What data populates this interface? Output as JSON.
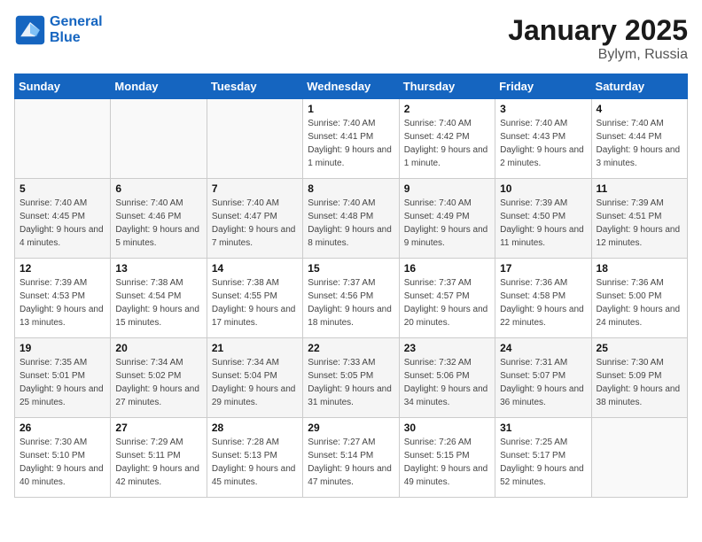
{
  "header": {
    "logo_line1": "General",
    "logo_line2": "Blue",
    "title": "January 2025",
    "subtitle": "Bylym, Russia"
  },
  "weekdays": [
    "Sunday",
    "Monday",
    "Tuesday",
    "Wednesday",
    "Thursday",
    "Friday",
    "Saturday"
  ],
  "weeks": [
    [
      {
        "day": "",
        "info": ""
      },
      {
        "day": "",
        "info": ""
      },
      {
        "day": "",
        "info": ""
      },
      {
        "day": "1",
        "info": "Sunrise: 7:40 AM\nSunset: 4:41 PM\nDaylight: 9 hours and 1 minute."
      },
      {
        "day": "2",
        "info": "Sunrise: 7:40 AM\nSunset: 4:42 PM\nDaylight: 9 hours and 1 minute."
      },
      {
        "day": "3",
        "info": "Sunrise: 7:40 AM\nSunset: 4:43 PM\nDaylight: 9 hours and 2 minutes."
      },
      {
        "day": "4",
        "info": "Sunrise: 7:40 AM\nSunset: 4:44 PM\nDaylight: 9 hours and 3 minutes."
      }
    ],
    [
      {
        "day": "5",
        "info": "Sunrise: 7:40 AM\nSunset: 4:45 PM\nDaylight: 9 hours and 4 minutes."
      },
      {
        "day": "6",
        "info": "Sunrise: 7:40 AM\nSunset: 4:46 PM\nDaylight: 9 hours and 5 minutes."
      },
      {
        "day": "7",
        "info": "Sunrise: 7:40 AM\nSunset: 4:47 PM\nDaylight: 9 hours and 7 minutes."
      },
      {
        "day": "8",
        "info": "Sunrise: 7:40 AM\nSunset: 4:48 PM\nDaylight: 9 hours and 8 minutes."
      },
      {
        "day": "9",
        "info": "Sunrise: 7:40 AM\nSunset: 4:49 PM\nDaylight: 9 hours and 9 minutes."
      },
      {
        "day": "10",
        "info": "Sunrise: 7:39 AM\nSunset: 4:50 PM\nDaylight: 9 hours and 11 minutes."
      },
      {
        "day": "11",
        "info": "Sunrise: 7:39 AM\nSunset: 4:51 PM\nDaylight: 9 hours and 12 minutes."
      }
    ],
    [
      {
        "day": "12",
        "info": "Sunrise: 7:39 AM\nSunset: 4:53 PM\nDaylight: 9 hours and 13 minutes."
      },
      {
        "day": "13",
        "info": "Sunrise: 7:38 AM\nSunset: 4:54 PM\nDaylight: 9 hours and 15 minutes."
      },
      {
        "day": "14",
        "info": "Sunrise: 7:38 AM\nSunset: 4:55 PM\nDaylight: 9 hours and 17 minutes."
      },
      {
        "day": "15",
        "info": "Sunrise: 7:37 AM\nSunset: 4:56 PM\nDaylight: 9 hours and 18 minutes."
      },
      {
        "day": "16",
        "info": "Sunrise: 7:37 AM\nSunset: 4:57 PM\nDaylight: 9 hours and 20 minutes."
      },
      {
        "day": "17",
        "info": "Sunrise: 7:36 AM\nSunset: 4:58 PM\nDaylight: 9 hours and 22 minutes."
      },
      {
        "day": "18",
        "info": "Sunrise: 7:36 AM\nSunset: 5:00 PM\nDaylight: 9 hours and 24 minutes."
      }
    ],
    [
      {
        "day": "19",
        "info": "Sunrise: 7:35 AM\nSunset: 5:01 PM\nDaylight: 9 hours and 25 minutes."
      },
      {
        "day": "20",
        "info": "Sunrise: 7:34 AM\nSunset: 5:02 PM\nDaylight: 9 hours and 27 minutes."
      },
      {
        "day": "21",
        "info": "Sunrise: 7:34 AM\nSunset: 5:04 PM\nDaylight: 9 hours and 29 minutes."
      },
      {
        "day": "22",
        "info": "Sunrise: 7:33 AM\nSunset: 5:05 PM\nDaylight: 9 hours and 31 minutes."
      },
      {
        "day": "23",
        "info": "Sunrise: 7:32 AM\nSunset: 5:06 PM\nDaylight: 9 hours and 34 minutes."
      },
      {
        "day": "24",
        "info": "Sunrise: 7:31 AM\nSunset: 5:07 PM\nDaylight: 9 hours and 36 minutes."
      },
      {
        "day": "25",
        "info": "Sunrise: 7:30 AM\nSunset: 5:09 PM\nDaylight: 9 hours and 38 minutes."
      }
    ],
    [
      {
        "day": "26",
        "info": "Sunrise: 7:30 AM\nSunset: 5:10 PM\nDaylight: 9 hours and 40 minutes."
      },
      {
        "day": "27",
        "info": "Sunrise: 7:29 AM\nSunset: 5:11 PM\nDaylight: 9 hours and 42 minutes."
      },
      {
        "day": "28",
        "info": "Sunrise: 7:28 AM\nSunset: 5:13 PM\nDaylight: 9 hours and 45 minutes."
      },
      {
        "day": "29",
        "info": "Sunrise: 7:27 AM\nSunset: 5:14 PM\nDaylight: 9 hours and 47 minutes."
      },
      {
        "day": "30",
        "info": "Sunrise: 7:26 AM\nSunset: 5:15 PM\nDaylight: 9 hours and 49 minutes."
      },
      {
        "day": "31",
        "info": "Sunrise: 7:25 AM\nSunset: 5:17 PM\nDaylight: 9 hours and 52 minutes."
      },
      {
        "day": "",
        "info": ""
      }
    ]
  ]
}
